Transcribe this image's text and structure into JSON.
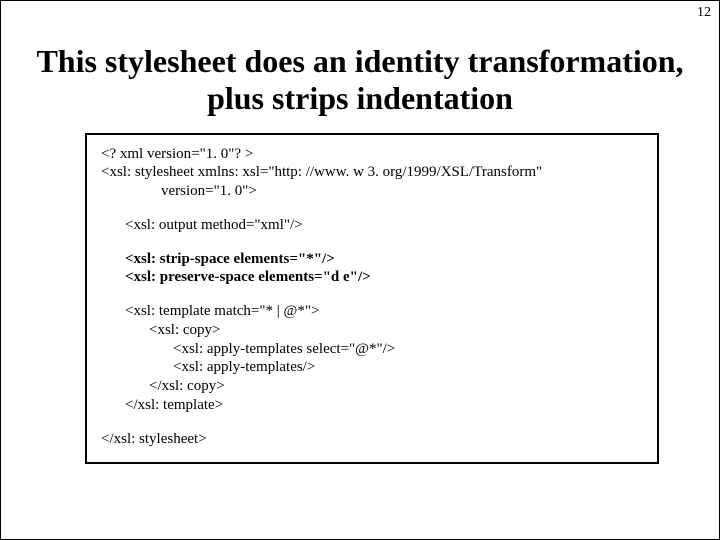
{
  "page_number": "12",
  "title": "This stylesheet does an identity transformation, plus strips indentation",
  "code": {
    "l1": "<? xml version=\"1. 0\"? >",
    "l2": "<xsl: stylesheet xmlns: xsl=\"http: //www. w 3. org/1999/XSL/Transform\"",
    "l3": "version=\"1. 0\">",
    "l4": "<xsl: output method=\"xml\"/>",
    "l5": "<xsl: strip-space elements=\"*\"/>",
    "l6": "<xsl: preserve-space elements=\"d e\"/>",
    "l7": "<xsl: template match=\"* | @*\">",
    "l8": "<xsl: copy>",
    "l9": "<xsl: apply-templates select=\"@*\"/>",
    "l10": "<xsl: apply-templates/>",
    "l11": "</xsl: copy>",
    "l12": "</xsl: template>",
    "l13": "</xsl: stylesheet>"
  }
}
